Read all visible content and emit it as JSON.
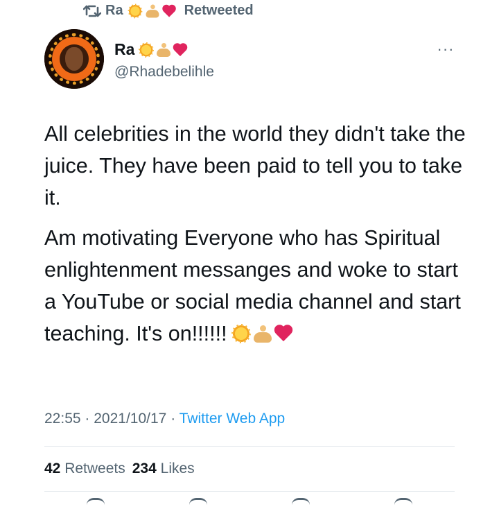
{
  "retweet_context": {
    "user": "Ra",
    "label": "Retweeted",
    "emojis": [
      "sun-icon",
      "person-lotus-icon",
      "red-heart-icon"
    ]
  },
  "author": {
    "display_name": "Ra",
    "handle": "@Rhadebelihle",
    "emojis": [
      "sun-icon",
      "person-lotus-icon",
      "red-heart-icon"
    ]
  },
  "menu": {
    "more_label": "···"
  },
  "tweet": {
    "paragraph1": "All celebrities in the world they didn't take the juice. They have been paid to tell you to take it.",
    "paragraph2": "Am motivating Everyone who has Spiritual enlightenment messanges and woke to start a YouTube or social media channel and start teaching. It's",
    "paragraph2_end": "on!!!!!!",
    "trailing_emojis": [
      "sun-icon",
      "person-lotus-icon",
      "red-heart-icon"
    ]
  },
  "meta": {
    "time": "22:55",
    "separator": "·",
    "date": "2021/10/17",
    "source": "Twitter Web App"
  },
  "stats": {
    "retweets_count": "42",
    "retweets_label": "Retweets",
    "likes_count": "234",
    "likes_label": "Likes"
  },
  "colors": {
    "text": "#0f1419",
    "secondary": "#536471",
    "link": "#1d9bf0",
    "heart": "#e0245e"
  }
}
